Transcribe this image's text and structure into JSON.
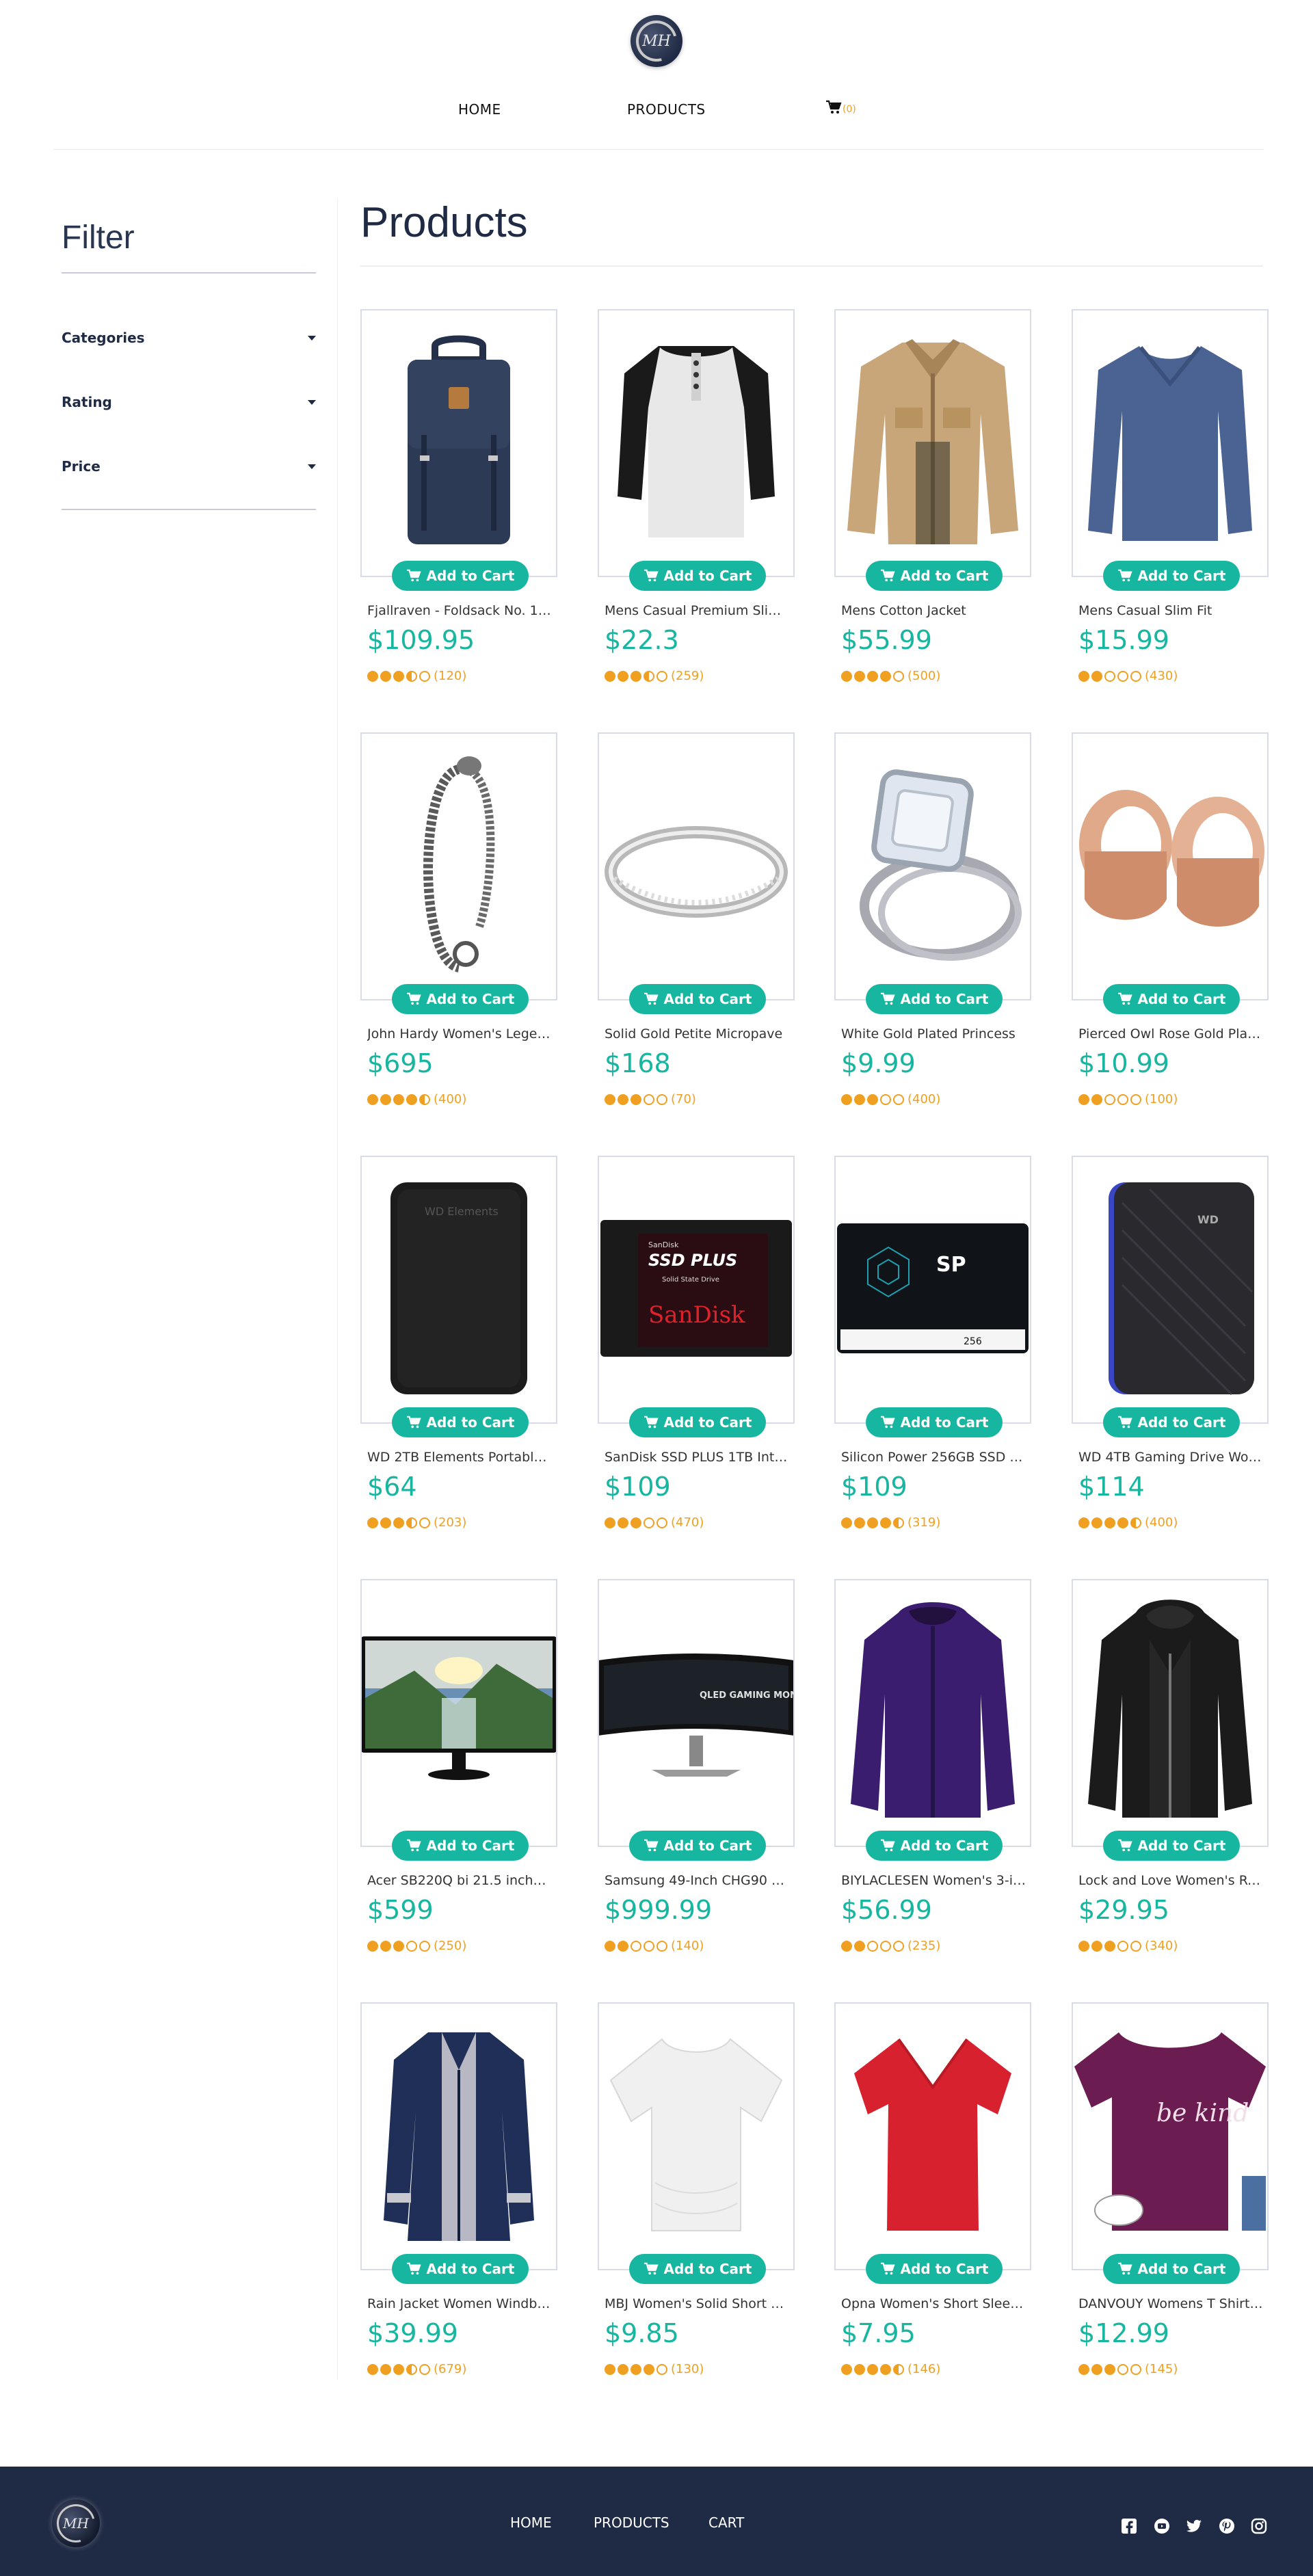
{
  "header": {
    "logo_text": "MH",
    "nav_home": "HOME",
    "nav_products": "PRODUCTS",
    "cart_count": "(0)"
  },
  "sidebar": {
    "title": "Filter",
    "filters": [
      "Categories",
      "Rating",
      "Price"
    ]
  },
  "main": {
    "title": "Products",
    "add_to_cart": "Add to Cart"
  },
  "products": [
    {
      "name": "Fjallraven - Foldsack No. 1 B...",
      "price": "$109.95",
      "rating": 3.5,
      "count": "(120)",
      "icon": "backpack-image"
    },
    {
      "name": "Mens Casual Premium Slim ...",
      "price": "$22.3",
      "rating": 3.5,
      "count": "(259)",
      "icon": "henley-shirt-image"
    },
    {
      "name": "Mens Cotton Jacket",
      "price": "$55.99",
      "rating": 4,
      "count": "(500)",
      "icon": "cotton-jacket-image"
    },
    {
      "name": "Mens Casual Slim Fit",
      "price": "$15.99",
      "rating": 2,
      "count": "(430)",
      "icon": "slim-fit-shirt-image"
    },
    {
      "name": "John Hardy Women's Legen...",
      "price": "$695",
      "rating": 4.5,
      "count": "(400)",
      "icon": "bracelet-image"
    },
    {
      "name": "Solid Gold Petite Micropave",
      "price": "$168",
      "rating": 3,
      "count": "(70)",
      "icon": "gold-ring-image"
    },
    {
      "name": "White Gold Plated Princess",
      "price": "$9.99",
      "rating": 3,
      "count": "(400)",
      "icon": "princess-ring-image"
    },
    {
      "name": "Pierced Owl Rose Gold Plat...",
      "price": "$10.99",
      "rating": 2,
      "count": "(100)",
      "icon": "rose-gold-plugs-image"
    },
    {
      "name": "WD 2TB Elements Portable ...",
      "price": "$64",
      "rating": 3.5,
      "count": "(203)",
      "icon": "wd-drive-image"
    },
    {
      "name": "SanDisk SSD PLUS 1TB Inte...",
      "price": "$109",
      "rating": 3,
      "count": "(470)",
      "icon": "sandisk-ssd-image"
    },
    {
      "name": "Silicon Power 256GB SSD 3...",
      "price": "$109",
      "rating": 4.5,
      "count": "(319)",
      "icon": "silicon-power-ssd-image"
    },
    {
      "name": "WD 4TB Gaming Drive Wor...",
      "price": "$114",
      "rating": 4.5,
      "count": "(400)",
      "icon": "wd-gaming-drive-image"
    },
    {
      "name": "Acer SB220Q bi 21.5 inches...",
      "price": "$599",
      "rating": 3,
      "count": "(250)",
      "icon": "acer-monitor-image"
    },
    {
      "name": "Samsung 49-Inch CHG90 1...",
      "price": "$999.99",
      "rating": 2,
      "count": "(140)",
      "icon": "samsung-monitor-image"
    },
    {
      "name": "BIYLACLESEN Women's 3-in...",
      "price": "$56.99",
      "rating": 2,
      "count": "(235)",
      "icon": "purple-jacket-image"
    },
    {
      "name": "Lock and Love Women's Re...",
      "price": "$29.95",
      "rating": 3,
      "count": "(340)",
      "icon": "leather-jacket-image"
    },
    {
      "name": "Rain Jacket Women Windbr...",
      "price": "$39.99",
      "rating": 3.5,
      "count": "(679)",
      "icon": "rain-jacket-image"
    },
    {
      "name": "MBJ Women's Solid Short Sl...",
      "price": "$9.85",
      "rating": 4,
      "count": "(130)",
      "icon": "white-tee-image"
    },
    {
      "name": "Opna Women's Short Sleev...",
      "price": "$7.95",
      "rating": 4.5,
      "count": "(146)",
      "icon": "red-tee-image"
    },
    {
      "name": "DANVOUY Womens T Shirt ...",
      "price": "$12.99",
      "rating": 3,
      "count": "(145)",
      "icon": "purple-tee-image",
      "print_text": "be kind"
    }
  ],
  "image_text": {
    "sandisk_title": "SSD PLUS",
    "sandisk_sub": "Solid State Drive",
    "sandisk_brand": "SanDisk",
    "sandisk_top": "SanDisk",
    "sp_brand": "SP",
    "sp_cap": "256",
    "samsung_text": "QLED GAMING MONITOR",
    "wd_label": "WD Elements",
    "wd_mark": "WD"
  },
  "footer": {
    "logo_text": "MH",
    "home": "HOME",
    "products": "PRODUCTS",
    "cart": "CART",
    "social": [
      "facebook-icon",
      "youtube-icon",
      "twitter-icon",
      "pinterest-icon",
      "instagram-icon"
    ]
  },
  "colors": {
    "accent": "#17b6a0",
    "star": "#f0a020",
    "navy": "#1f2a44"
  }
}
